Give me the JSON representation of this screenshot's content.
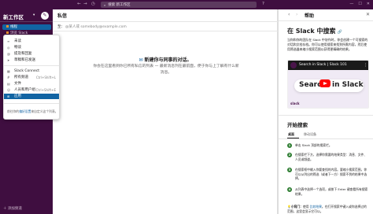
{
  "topbar": {
    "search_text": "搜索 新工作区",
    "history_icon": "clock-icon",
    "back_icon": "arrow-left-icon",
    "forward_icon": "arrow-right-icon",
    "help_icon": "question-circle-icon"
  },
  "sidebar": {
    "workspace_name": "新工作区",
    "items": [
      {
        "label": "线程"
      },
      {
        "label": "浏览 Slack"
      }
    ],
    "bottom_label": "添加频道"
  },
  "menu": {
    "items": [
      {
        "label": "未读",
        "shortcut": ""
      },
      {
        "label": "畅谈",
        "shortcut": ""
      },
      {
        "label": "提及和回复",
        "shortcut": ""
      },
      {
        "label": "草稿和已发送",
        "shortcut": ""
      },
      {
        "label": "Slack Connect",
        "shortcut": ""
      },
      {
        "label": "所有频道",
        "shortcut": "Ctrl+Shift+L"
      },
      {
        "label": "文件",
        "shortcut": ""
      },
      {
        "label": "人员和用户组",
        "shortcut": "Ctrl+Shift+E"
      },
      {
        "label": "应用",
        "shortcut": ""
      }
    ],
    "footer_prefix": "前往你的",
    "footer_link": "偏好设置",
    "footer_suffix": "来自定义这个列表。"
  },
  "main": {
    "title": "私信",
    "to_label": "至：",
    "to_placeholder": "@某人或 somebody@example.com",
    "empty_title": "新建你与同事的对话。",
    "empty_body": "你会在这里看到你已所有私信的列表 — 最新消息列在最前面，便于你与上了解有什么新消息。"
  },
  "help": {
    "header_title": "帮助",
    "h1": "在 Slack 中搜索",
    "intro": "当你和你的团队在 Slack 中协作时，你会创建一个可搜索的对话和文档存档。你可以使用搜索来找到所需内容，然后使用筛选器来缩小搜索范围以获得更精确的结果。",
    "video_title": "Search in Slack | Slack 101",
    "video_word1": "Search",
    "video_word2": "in Slack",
    "video_brand": "slack",
    "h2": "开始搜索",
    "tabs": [
      "桌面",
      "移动设备"
    ],
    "steps": [
      "单击 Slack 顶部的搜索栏。",
      "在搜索栏下方，选择你需要的结果类型：消息、文件、人员或频道。",
      "在搜索框中输入你要查找的内容。要缩小搜索范围，你可以从列出的筛选（或者下一方）搜索不到的结果中选择。",
      "从列表中选择一个选项，或按下 Enter 键查看所有搜索结果。"
    ],
    "tip_bold": "小窍门：",
    "tip_text": "使用 ",
    "tip_link": "比较结果",
    "tip_rest": "。在打开搜索中键入或你选择过的范围，这里会显示它可以。"
  }
}
